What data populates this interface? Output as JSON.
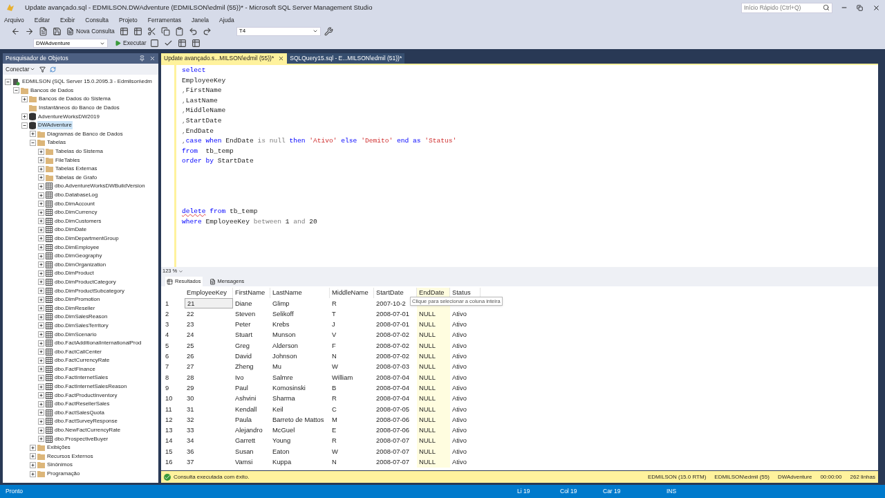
{
  "window": {
    "title": "Update avançado.sql - EDMILSON.DWAdventure (EDMILSON\\edmil (55))* - Microsoft SQL Server Management Studio",
    "quick_launch": {
      "placeholder": "Início Rápido (Ctrl+Q)"
    }
  },
  "menu": [
    "Arquivo",
    "Editar",
    "Exibir",
    "Consulta",
    "Projeto",
    "Ferramentas",
    "Janela",
    "Ajuda"
  ],
  "toolbar": {
    "new_query": "Nova Consulta",
    "solution_config": "T4",
    "database": "DWAdventure",
    "execute": "Executar"
  },
  "object_explorer": {
    "title": "Pesquisador de Objetos",
    "connect": "Conectar",
    "tree": [
      {
        "label": "EDMILSON (SQL Server 15.0.2095.3 - Edmilson\\edm",
        "kind": "server",
        "expanded": true,
        "children": [
          {
            "label": "Bancos de Dados",
            "kind": "folder",
            "expanded": true,
            "children": [
              {
                "label": "Bancos de Dados do Sistema",
                "kind": "folder",
                "expanded": false
              },
              {
                "label": "Instantâneos do Banco de Dados",
                "kind": "folder"
              },
              {
                "label": "AdventureWorksDW2019",
                "kind": "database",
                "expanded": false
              },
              {
                "label": "DWAdventure",
                "kind": "database",
                "expanded": true,
                "selected": true,
                "children": [
                  {
                    "label": "Diagramas de Banco de Dados",
                    "kind": "folder",
                    "expanded": false
                  },
                  {
                    "label": "Tabelas",
                    "kind": "folder",
                    "expanded": true,
                    "children": [
                      {
                        "label": "Tabelas do Sistema",
                        "kind": "folder",
                        "expanded": false
                      },
                      {
                        "label": "FileTables",
                        "kind": "folder",
                        "expanded": false
                      },
                      {
                        "label": "Tabelas Externas",
                        "kind": "folder",
                        "expanded": false
                      },
                      {
                        "label": "Tabelas de Grafo",
                        "kind": "folder",
                        "expanded": false
                      },
                      {
                        "label": "dbo.AdventureWorksDWBuildVersion",
                        "kind": "table",
                        "expanded": false
                      },
                      {
                        "label": "dbo.DatabaseLog",
                        "kind": "table",
                        "expanded": false
                      },
                      {
                        "label": "dbo.DimAccount",
                        "kind": "table",
                        "expanded": false
                      },
                      {
                        "label": "dbo.DimCurrency",
                        "kind": "table",
                        "expanded": false
                      },
                      {
                        "label": "dbo.DimCustomers",
                        "kind": "table",
                        "expanded": false
                      },
                      {
                        "label": "dbo.DimDate",
                        "kind": "table",
                        "expanded": false
                      },
                      {
                        "label": "dbo.DimDepartmentGroup",
                        "kind": "table",
                        "expanded": false
                      },
                      {
                        "label": "dbo.DimEmployee",
                        "kind": "table",
                        "expanded": false
                      },
                      {
                        "label": "dbo.DimGeography",
                        "kind": "table",
                        "expanded": false
                      },
                      {
                        "label": "dbo.DimOrganization",
                        "kind": "table",
                        "expanded": false
                      },
                      {
                        "label": "dbo.DimProduct",
                        "kind": "table",
                        "expanded": false
                      },
                      {
                        "label": "dbo.DimProductCategory",
                        "kind": "table",
                        "expanded": false
                      },
                      {
                        "label": "dbo.DimProductSubcategory",
                        "kind": "table",
                        "expanded": false
                      },
                      {
                        "label": "dbo.DimPromotion",
                        "kind": "table",
                        "expanded": false
                      },
                      {
                        "label": "dbo.DimReseller",
                        "kind": "table",
                        "expanded": false
                      },
                      {
                        "label": "dbo.DimSalesReason",
                        "kind": "table",
                        "expanded": false
                      },
                      {
                        "label": "dbo.DimSalesTerritory",
                        "kind": "table",
                        "expanded": false
                      },
                      {
                        "label": "dbo.DimScenario",
                        "kind": "table",
                        "expanded": false
                      },
                      {
                        "label": "dbo.FactAdditionalInternationalProd",
                        "kind": "table",
                        "expanded": false
                      },
                      {
                        "label": "dbo.FactCallCenter",
                        "kind": "table",
                        "expanded": false
                      },
                      {
                        "label": "dbo.FactCurrencyRate",
                        "kind": "table",
                        "expanded": false
                      },
                      {
                        "label": "dbo.FactFinance",
                        "kind": "table",
                        "expanded": false
                      },
                      {
                        "label": "dbo.FactInternetSales",
                        "kind": "table",
                        "expanded": false
                      },
                      {
                        "label": "dbo.FactInternetSalesReason",
                        "kind": "table",
                        "expanded": false
                      },
                      {
                        "label": "dbo.FactProductInventory",
                        "kind": "table",
                        "expanded": false
                      },
                      {
                        "label": "dbo.FactResellerSales",
                        "kind": "table",
                        "expanded": false
                      },
                      {
                        "label": "dbo.FactSalesQuota",
                        "kind": "table",
                        "expanded": false
                      },
                      {
                        "label": "dbo.FactSurveyResponse",
                        "kind": "table",
                        "expanded": false
                      },
                      {
                        "label": "dbo.NewFactCurrencyRate",
                        "kind": "table",
                        "expanded": false
                      },
                      {
                        "label": "dbo.ProspectiveBuyer",
                        "kind": "table",
                        "expanded": false
                      }
                    ]
                  },
                  {
                    "label": "Exibições",
                    "kind": "folder",
                    "expanded": false
                  },
                  {
                    "label": "Recursos Externos",
                    "kind": "folder",
                    "expanded": false
                  },
                  {
                    "label": "Sinônimos",
                    "kind": "folder",
                    "expanded": false
                  },
                  {
                    "label": "Programação",
                    "kind": "folder",
                    "expanded": false
                  }
                ]
              }
            ]
          }
        ]
      }
    ]
  },
  "editor_tabs": [
    {
      "label": "Update avançado.s...MILSON\\edmil (55))*",
      "selected": true
    },
    {
      "label": "SQLQuery15.sql - E...MILSON\\edmil (51))*",
      "selected": false
    }
  ],
  "code_blocks": [
    {
      "lines": [
        [
          {
            "text": "select",
            "kind": "keyword"
          }
        ],
        [
          {
            "text": "EmployeeKey",
            "kind": "plain"
          }
        ],
        [
          {
            "text": ",",
            "kind": "operator"
          },
          {
            "text": "FirstName",
            "kind": "plain"
          }
        ],
        [
          {
            "text": ",",
            "kind": "operator"
          },
          {
            "text": "LastName",
            "kind": "plain"
          }
        ],
        [
          {
            "text": ",",
            "kind": "operator"
          },
          {
            "text": "MiddleName",
            "kind": "plain"
          }
        ],
        [
          {
            "text": ",",
            "kind": "operator"
          },
          {
            "text": "StartDate",
            "kind": "plain"
          }
        ],
        [
          {
            "text": ",",
            "kind": "operator"
          },
          {
            "text": "EndDate",
            "kind": "plain"
          }
        ],
        [
          {
            "text": ",",
            "kind": "operator"
          },
          {
            "text": "case",
            "kind": "keyword"
          },
          {
            "text": " when",
            "kind": "keyword"
          },
          {
            "text": " EndDate ",
            "kind": "plain"
          },
          {
            "text": "is null",
            "kind": "operator"
          },
          {
            "text": " then",
            "kind": "keyword"
          },
          {
            "text": " 'Ativo'",
            "kind": "string"
          },
          {
            "text": " else",
            "kind": "keyword"
          },
          {
            "text": " 'Demito'",
            "kind": "string"
          },
          {
            "text": " end",
            "kind": "keyword"
          },
          {
            "text": " as",
            "kind": "keyword"
          },
          {
            "text": " 'Status'",
            "kind": "string"
          }
        ],
        [
          {
            "text": "from",
            "kind": "keyword"
          },
          {
            "text": "  tb_temp",
            "kind": "plain"
          }
        ],
        [
          {
            "text": "order by",
            "kind": "keyword"
          },
          {
            "text": " StartDate",
            "kind": "plain"
          }
        ]
      ]
    },
    {
      "lines": [
        [
          {
            "text": "delete",
            "kind": "error_keyword"
          },
          {
            "text": " from",
            "kind": "keyword"
          },
          {
            "text": " tb_temp",
            "kind": "plain"
          }
        ],
        [
          {
            "text": "where",
            "kind": "keyword"
          },
          {
            "text": " EmployeeKey ",
            "kind": "plain"
          },
          {
            "text": "between",
            "kind": "operator"
          },
          {
            "text": " 1 ",
            "kind": "plain"
          },
          {
            "text": "and",
            "kind": "operator"
          },
          {
            "text": " 20",
            "kind": "plain"
          }
        ]
      ]
    }
  ],
  "zoom": "123 %",
  "result_tabs": [
    {
      "label": "Resultados",
      "selected": true
    },
    {
      "label": "Mensagens",
      "selected": false
    }
  ],
  "grid": {
    "columns": [
      {
        "label": "EmployeeKey",
        "selected": false
      },
      {
        "label": "FirstName",
        "selected": false
      },
      {
        "label": "LastName",
        "selected": false
      },
      {
        "label": "MiddleName",
        "selected": false
      },
      {
        "label": "StartDate",
        "selected": false
      },
      {
        "label": "EndDate",
        "selected": true
      },
      {
        "label": "Status",
        "selected": false
      }
    ],
    "tooltip": "Clique para selecionar a coluna inteira",
    "rows": [
      {
        "number": "1",
        "focused": true,
        "cells": [
          "21",
          "Diane",
          "Glimp",
          "R",
          "2007-10-2"
        ]
      },
      {
        "number": "2",
        "focused": false,
        "cells": [
          "22",
          "Steven",
          "Selikoff",
          "T",
          "2008-07-01",
          "NULL",
          "Ativo"
        ]
      },
      {
        "number": "3",
        "focused": false,
        "cells": [
          "23",
          "Peter",
          "Krebs",
          "J",
          "2008-07-01",
          "NULL",
          "Ativo"
        ]
      },
      {
        "number": "4",
        "focused": false,
        "cells": [
          "24",
          "Stuart",
          "Munson",
          "V",
          "2008-07-02",
          "NULL",
          "Ativo"
        ]
      },
      {
        "number": "5",
        "focused": false,
        "cells": [
          "25",
          "Greg",
          "Alderson",
          "F",
          "2008-07-02",
          "NULL",
          "Ativo"
        ]
      },
      {
        "number": "6",
        "focused": false,
        "cells": [
          "26",
          "David",
          "Johnson",
          "N",
          "2008-07-02",
          "NULL",
          "Ativo"
        ]
      },
      {
        "number": "7",
        "focused": false,
        "cells": [
          "27",
          "Zheng",
          "Mu",
          "W",
          "2008-07-03",
          "NULL",
          "Ativo"
        ]
      },
      {
        "number": "8",
        "focused": false,
        "cells": [
          "28",
          "Ivo",
          "Salmre",
          "William",
          "2008-07-04",
          "NULL",
          "Ativo"
        ]
      },
      {
        "number": "9",
        "focused": false,
        "cells": [
          "29",
          "Paul",
          "Komosinski",
          "B",
          "2008-07-04",
          "NULL",
          "Ativo"
        ]
      },
      {
        "number": "10",
        "focused": false,
        "cells": [
          "30",
          "Ashvini",
          "Sharma",
          "R",
          "2008-07-04",
          "NULL",
          "Ativo"
        ]
      },
      {
        "number": "11",
        "focused": false,
        "cells": [
          "31",
          "Kendall",
          "Keil",
          "C",
          "2008-07-05",
          "NULL",
          "Ativo"
        ]
      },
      {
        "number": "12",
        "focused": false,
        "cells": [
          "32",
          "Paula",
          "Barreto de Mattos",
          "M",
          "2008-07-06",
          "NULL",
          "Ativo"
        ]
      },
      {
        "number": "13",
        "focused": false,
        "cells": [
          "33",
          "Alejandro",
          "McGuel",
          "E",
          "2008-07-06",
          "NULL",
          "Ativo"
        ]
      },
      {
        "number": "14",
        "focused": false,
        "cells": [
          "34",
          "Garrett",
          "Young",
          "R",
          "2008-07-07",
          "NULL",
          "Ativo"
        ]
      },
      {
        "number": "15",
        "focused": false,
        "cells": [
          "36",
          "Susan",
          "Eaton",
          "W",
          "2008-07-07",
          "NULL",
          "Ativo"
        ]
      },
      {
        "number": "16",
        "focused": false,
        "cells": [
          "37",
          "Vamsi",
          "Kuppa",
          "N",
          "2008-07-07",
          "NULL",
          "Ativo"
        ]
      }
    ]
  },
  "query_status": {
    "message": "Consulta executada com êxito.",
    "server": "EDMILSON (15.0 RTM)",
    "login": "EDMILSON\\edmil (55)",
    "database": "DWAdventure",
    "elapsed": "00:00:00",
    "rows": "262 linhas"
  },
  "status_bar": {
    "state": "Pronto",
    "line": "Li 19",
    "column": "Col 19",
    "char": "Car 19",
    "mode": "INS"
  }
}
